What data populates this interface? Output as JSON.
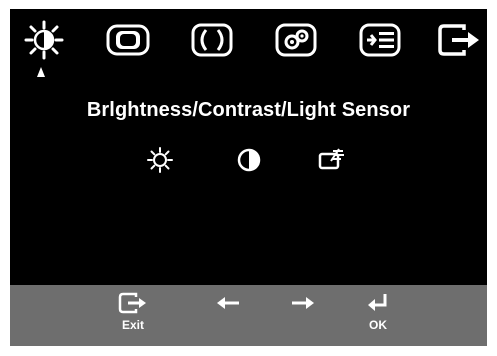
{
  "menu": {
    "tabs": [
      {
        "icon": "brightness-icon",
        "selected": true
      },
      {
        "icon": "image-position-icon",
        "selected": false
      },
      {
        "icon": "image-setup-icon",
        "selected": false
      },
      {
        "icon": "settings-icon",
        "selected": false
      },
      {
        "icon": "options-icon",
        "selected": false
      },
      {
        "icon": "exit-icon",
        "selected": false
      }
    ]
  },
  "panel": {
    "title": "Brlghtness/Contrast/Light Sensor",
    "items": [
      {
        "icon": "brightness-icon"
      },
      {
        "icon": "contrast-icon"
      },
      {
        "icon": "light-sensor-icon"
      }
    ]
  },
  "footer": {
    "exit_label": "Exit",
    "ok_label": "OK",
    "buttons": [
      {
        "icon": "exit-icon"
      },
      {
        "icon": "left-arrow-icon"
      },
      {
        "icon": "right-arrow-icon"
      },
      {
        "icon": "enter-icon"
      }
    ]
  },
  "colors": {
    "screen_bg": "#000000",
    "foreground": "#ffffff",
    "footer_bg": "#6e6e6e"
  }
}
